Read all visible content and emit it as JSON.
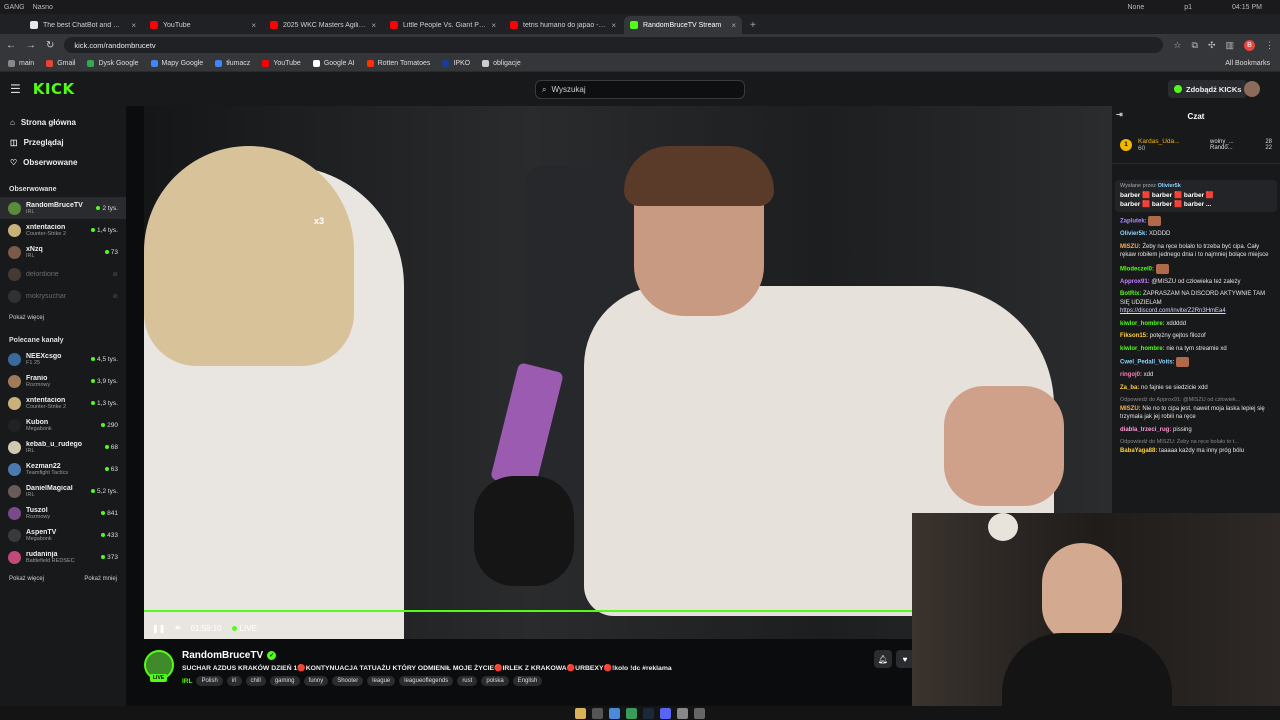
{
  "os": {
    "workspace": "GANG",
    "network": "Nasno",
    "weather": "None",
    "user": "p1",
    "clock": "04:15 PM"
  },
  "browser": {
    "tabs": [
      {
        "label": "The best ChatBot and Widg",
        "color": "#e8e8e8",
        "active": false
      },
      {
        "label": "YouTube",
        "color": "#ff0000",
        "active": false
      },
      {
        "label": "2025 WKC Masters Agility C",
        "color": "#ff0000",
        "active": false
      },
      {
        "label": "Little People Vs. Giant Peop",
        "color": "#ff0000",
        "active": false
      },
      {
        "label": "tetris humano do japao - Yo",
        "color": "#ff0000",
        "active": false
      },
      {
        "label": "RandomBruceTV Stream",
        "color": "#53fc18",
        "active": true
      }
    ],
    "url": "kick.com/randombrucetv",
    "bookmarks": [
      {
        "label": "main",
        "color": "#888888"
      },
      {
        "label": "Gmail",
        "color": "#ea4335"
      },
      {
        "label": "Dysk Google",
        "color": "#34a853"
      },
      {
        "label": "Mapy Google",
        "color": "#4285f4"
      },
      {
        "label": "tłumacz",
        "color": "#4285f4"
      },
      {
        "label": "YouTube",
        "color": "#ff0000"
      },
      {
        "label": "Google AI",
        "color": "#ffffff"
      },
      {
        "label": "Rotten Tomatoes",
        "color": "#fa320a"
      },
      {
        "label": "IPKO",
        "color": "#1a3d8f"
      },
      {
        "label": "obligacje",
        "color": "#cccccc"
      }
    ],
    "all_bookmarks": "All Bookmarks"
  },
  "kick": {
    "logo": "KICK",
    "search_placeholder": "Wyszukaj",
    "get_kicks": "Zdobądź KICKs"
  },
  "sidebar": {
    "nav": [
      {
        "label": "Strona główna",
        "icon": "home-icon"
      },
      {
        "label": "Przeglądaj",
        "icon": "browse-icon"
      },
      {
        "label": "Obserwowane",
        "icon": "heart-icon"
      }
    ],
    "followed_title": "Obserwowane",
    "followed": [
      {
        "name": "RandomBruceTV",
        "cat": "IRL",
        "viewers": "2 tys.",
        "color": "#5a8a3a",
        "live": true,
        "selected": true
      },
      {
        "name": "xntentacion",
        "cat": "Counter-Strike 2",
        "viewers": "1,4 tys.",
        "color": "#c9b27a",
        "live": true
      },
      {
        "name": "xNzq",
        "cat": "IRL",
        "viewers": "73",
        "color": "#7a5a4a",
        "live": true
      },
      {
        "name": "delordione",
        "cat": "",
        "viewers": "",
        "color": "#8a6a5a",
        "live": false
      },
      {
        "name": "mokrysuchar",
        "cat": "",
        "viewers": "",
        "color": "#555555",
        "live": false
      }
    ],
    "followed_more": "Pokaż więcej",
    "recommended_title": "Polecane kanały",
    "recommended": [
      {
        "name": "NEEXcsgo",
        "cat": "F1 25",
        "viewers": "4,5 tys.",
        "color": "#3a6a9a"
      },
      {
        "name": "Franio",
        "cat": "Rozmowy",
        "viewers": "3,9 tys.",
        "color": "#a07a5a"
      },
      {
        "name": "xntentacion",
        "cat": "Counter-Strike 2",
        "viewers": "1,3 tys.",
        "color": "#c9b27a"
      },
      {
        "name": "Kubon",
        "cat": "Megabonk",
        "viewers": "290",
        "color": "#222222"
      },
      {
        "name": "kebab_u_rudego",
        "cat": "IRL",
        "viewers": "68",
        "color": "#d0c8b0"
      },
      {
        "name": "Kezman22",
        "cat": "Teamfight Tactics",
        "viewers": "63",
        "color": "#4a7ab0"
      },
      {
        "name": "DanielMagical",
        "cat": "IRL",
        "viewers": "5,2 tys.",
        "color": "#6a5a5a"
      },
      {
        "name": "Tuszol",
        "cat": "Rozmowy",
        "viewers": "841",
        "color": "#7a4a8a"
      },
      {
        "name": "AspenTV",
        "cat": "Megabonk",
        "viewers": "433",
        "color": "#3a3a3a"
      },
      {
        "name": "rudaninja",
        "cat": "Battlefield REDSEC",
        "viewers": "373",
        "color": "#c04a7a"
      }
    ],
    "show_more": "Pokaż więcej",
    "show_less": "Pokaż mniej"
  },
  "player": {
    "multiplier": "x3",
    "time": "01:59:10",
    "live_label": "LIVE"
  },
  "stream": {
    "channel": "RandomBruceTV",
    "live_badge": "LIVE",
    "title": "SUCHAR AZDUS KRAKÓW DZIEŃ 1🔴KONTYNUACJA TATUAŻU KTÓRY ODMIENIŁ MOJE  ŻYCIE🔴IRLEK Z KRAKOWA🔴URBEXY🔴!kolo !dc #reklama",
    "category": "IRL",
    "tags": [
      "Polish",
      "irl",
      "chill",
      "gaming",
      "funny",
      "Shooter",
      "league",
      "leagueoflegends",
      "rust",
      "polska",
      "English"
    ]
  },
  "chat": {
    "title": "Czat",
    "leader": {
      "name": "Kardas_Uda...",
      "count": "60"
    },
    "leader_side": [
      {
        "name": "wolny_...",
        "count": "28"
      },
      {
        "name": "Rando...",
        "count": "22"
      }
    ],
    "pinned_by_label": "Wysłane przez",
    "pinned_by": "Olivier5k",
    "pinned_rows": [
      "barber 🟥 barber 🟥 barber 🟥",
      "barber 🟥 barber 🟥 barber ..."
    ],
    "messages": [
      {
        "user": "Zaplutek:",
        "color": "#a98bff",
        "text": "",
        "emote": true
      },
      {
        "user": "Olivier5k:",
        "color": "#8ad4ff",
        "text": "XDDDD"
      },
      {
        "user": "MISZU:",
        "color": "#ffb347",
        "text": "Żeby na ręce bolało to trzeba być cipa. Cały rękaw robiłem jednego dnia i to najmniej bolące miejsce"
      },
      {
        "user": "Mlodeczel0:",
        "color": "#53fc18",
        "text": "",
        "emote": true
      },
      {
        "user": "Approx91:",
        "color": "#c77dff",
        "text": "@MISZU od człowieka też zależy"
      },
      {
        "user": "BotRix:",
        "color": "#53fc18",
        "text": "ZAPRASZAM NA DISCORD AKTYWNIE TAM SIĘ UDZIELAM",
        "link": "https://discord.com/invite/Z2Rn3HmEa4"
      },
      {
        "user": "kiwlor_hombre:",
        "color": "#53fc18",
        "text": "xddddd"
      },
      {
        "user": "Fikson15:",
        "color": "#ffd23f",
        "text": "potężny gejtos filozof"
      },
      {
        "user": "kiwlor_hombre:",
        "color": "#53fc18",
        "text": "nie na tym streamie xd"
      },
      {
        "user": "Cwel_Pedall_Voits:",
        "color": "#8ad4ff",
        "text": "",
        "emote": true
      },
      {
        "user": "ringoj0:",
        "color": "#ff7eb6",
        "text": "xdd"
      },
      {
        "user": "Za_ba:",
        "color": "#ffd23f",
        "text": "no fajnie se siedzicie xdd"
      },
      {
        "user": "MISZU:",
        "color": "#ffb347",
        "reply": "Odpowiedź do Approx91: @MISZU od człowiek...",
        "text": "Nie no to cipa jest. nawet moja laska lepiej się trzymała jak jej robili na ręce"
      },
      {
        "user": "diabla_trzeci_rug:",
        "color": "#ff9ad5",
        "text": "pissing"
      },
      {
        "user": "BabaYaga88:",
        "color": "#ffd23f",
        "reply": "Odpowiedź do MISZU: Żeby na ręce bolało to t...",
        "text": "taaaaa każdy ma inny próg bólu"
      }
    ]
  }
}
